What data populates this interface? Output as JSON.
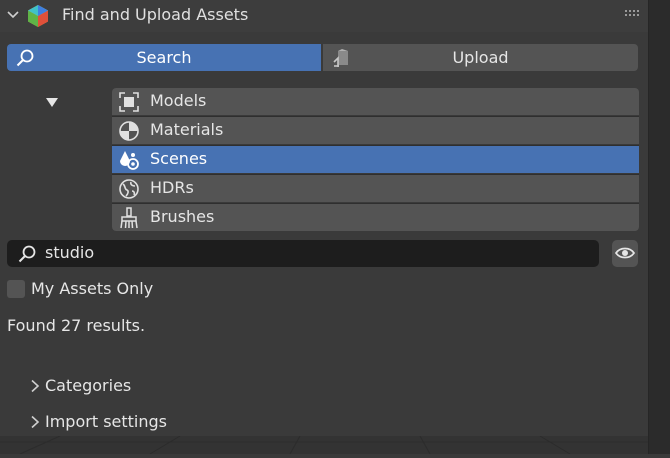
{
  "header": {
    "title": "Find and Upload Assets"
  },
  "mode_tabs": {
    "search_label": "Search",
    "upload_label": "Upload",
    "active": "Search"
  },
  "categories": {
    "items": [
      {
        "label": "Models",
        "icon": "models-icon"
      },
      {
        "label": "Materials",
        "icon": "materials-icon"
      },
      {
        "label": "Scenes",
        "icon": "scenes-icon"
      },
      {
        "label": "HDRs",
        "icon": "hdrs-icon"
      },
      {
        "label": "Brushes",
        "icon": "brushes-icon"
      }
    ],
    "selected": "Scenes"
  },
  "search": {
    "value": "studio"
  },
  "my_assets_only": {
    "label": "My Assets Only",
    "checked": false
  },
  "results_text": "Found 27 results.",
  "panels": {
    "categories_label": "Categories",
    "import_settings_label": "Import settings"
  },
  "colors": {
    "accent": "#4772b3",
    "background": "#3a3a3a",
    "button": "#545454",
    "field": "#1d1d1d"
  }
}
